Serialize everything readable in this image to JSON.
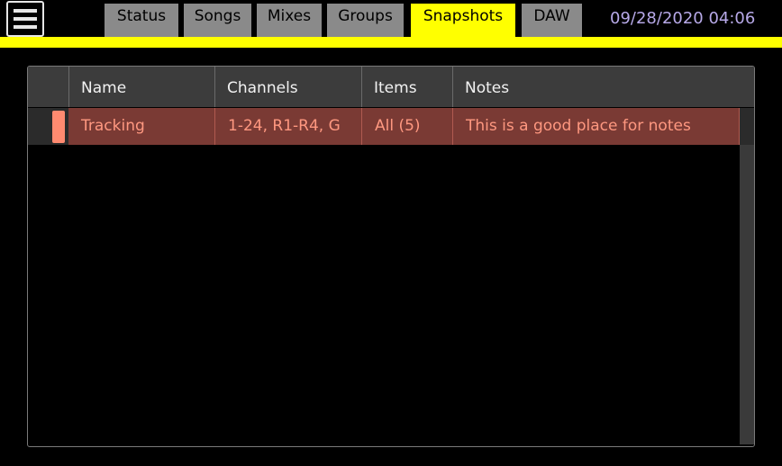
{
  "header": {
    "tabs": [
      {
        "label": "Status",
        "active": false
      },
      {
        "label": "Songs",
        "active": false
      },
      {
        "label": "Mixes",
        "active": false
      },
      {
        "label": "Groups",
        "active": false
      },
      {
        "label": "Snapshots",
        "active": true
      },
      {
        "label": "DAW",
        "active": false
      }
    ],
    "datetime": "09/28/2020 04:06",
    "icons": {
      "menu": "hamburger-menu-icon"
    }
  },
  "table": {
    "columns": [
      "Name",
      "Channels",
      "Items",
      "Notes"
    ],
    "rows": [
      {
        "name": "Tracking",
        "channels": "1-24, R1-R4, G",
        "items": "All (5)",
        "notes": "This is a good place for notes",
        "selected": true
      }
    ]
  },
  "colors": {
    "accent": "#ffff00",
    "tab_inactive": "#8a8a8a",
    "datetime": "#b7a9e8",
    "selected_row_bg": "#7a3a34",
    "selected_row_text": "#ff9880",
    "selected_marker": "#ff8a70"
  }
}
